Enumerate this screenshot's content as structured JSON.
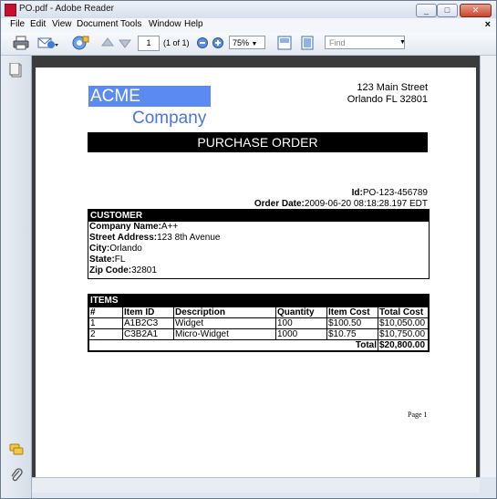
{
  "window": {
    "title": "PO.pdf - Adobe Reader"
  },
  "menu": {
    "items": [
      {
        "label": "File"
      },
      {
        "label": "Edit"
      },
      {
        "label": "View"
      },
      {
        "label": "Document"
      },
      {
        "label": "Tools"
      },
      {
        "label": "Window"
      },
      {
        "label": "Help"
      }
    ],
    "close_glyph": "×"
  },
  "toolbar": {
    "page_number": "1",
    "page_of": "(1 of 1)",
    "zoom": "75%",
    "find_placeholder": "Find"
  },
  "document": {
    "logo_line1": "ACME",
    "logo_line2": "Company",
    "address_line1": "123 Main Street",
    "address_line2": "Orlando FL 32801",
    "banner": "PURCHASE ORDER",
    "id_label": "Id:",
    "id_value": "PO-123-456789",
    "order_date_label": "Order Date:",
    "order_date_value": "2009-06-20 08:18:28.197 EDT",
    "customer": {
      "heading": "CUSTOMER",
      "rows": [
        {
          "label": "Company Name:",
          "value": "A++"
        },
        {
          "label": "Street Address:",
          "value": "123 8th Avenue"
        },
        {
          "label": "City:",
          "value": "Orlando"
        },
        {
          "label": "State:",
          "value": "FL"
        },
        {
          "label": "Zip Code:",
          "value": "32801"
        }
      ]
    },
    "items": {
      "heading": "ITEMS",
      "columns": [
        "#",
        "Item ID",
        "Description",
        "Quantity",
        "Item Cost",
        "Total Cost"
      ],
      "rows": [
        [
          "1",
          "A1B2C3",
          "Widget",
          "100",
          "$100.50",
          "$10,050.00"
        ],
        [
          "2",
          "C3B2A1",
          "Micro-Widget",
          "1000",
          "$10.75",
          "$10,750.00"
        ]
      ],
      "total_label": "Total",
      "total_value": "$20,800.00"
    },
    "page_label": "Page 1"
  },
  "colors": {
    "logo_blue": "#5b8bf2",
    "company_blue": "#4a73e8",
    "doc_background": "#3b3b3b"
  }
}
